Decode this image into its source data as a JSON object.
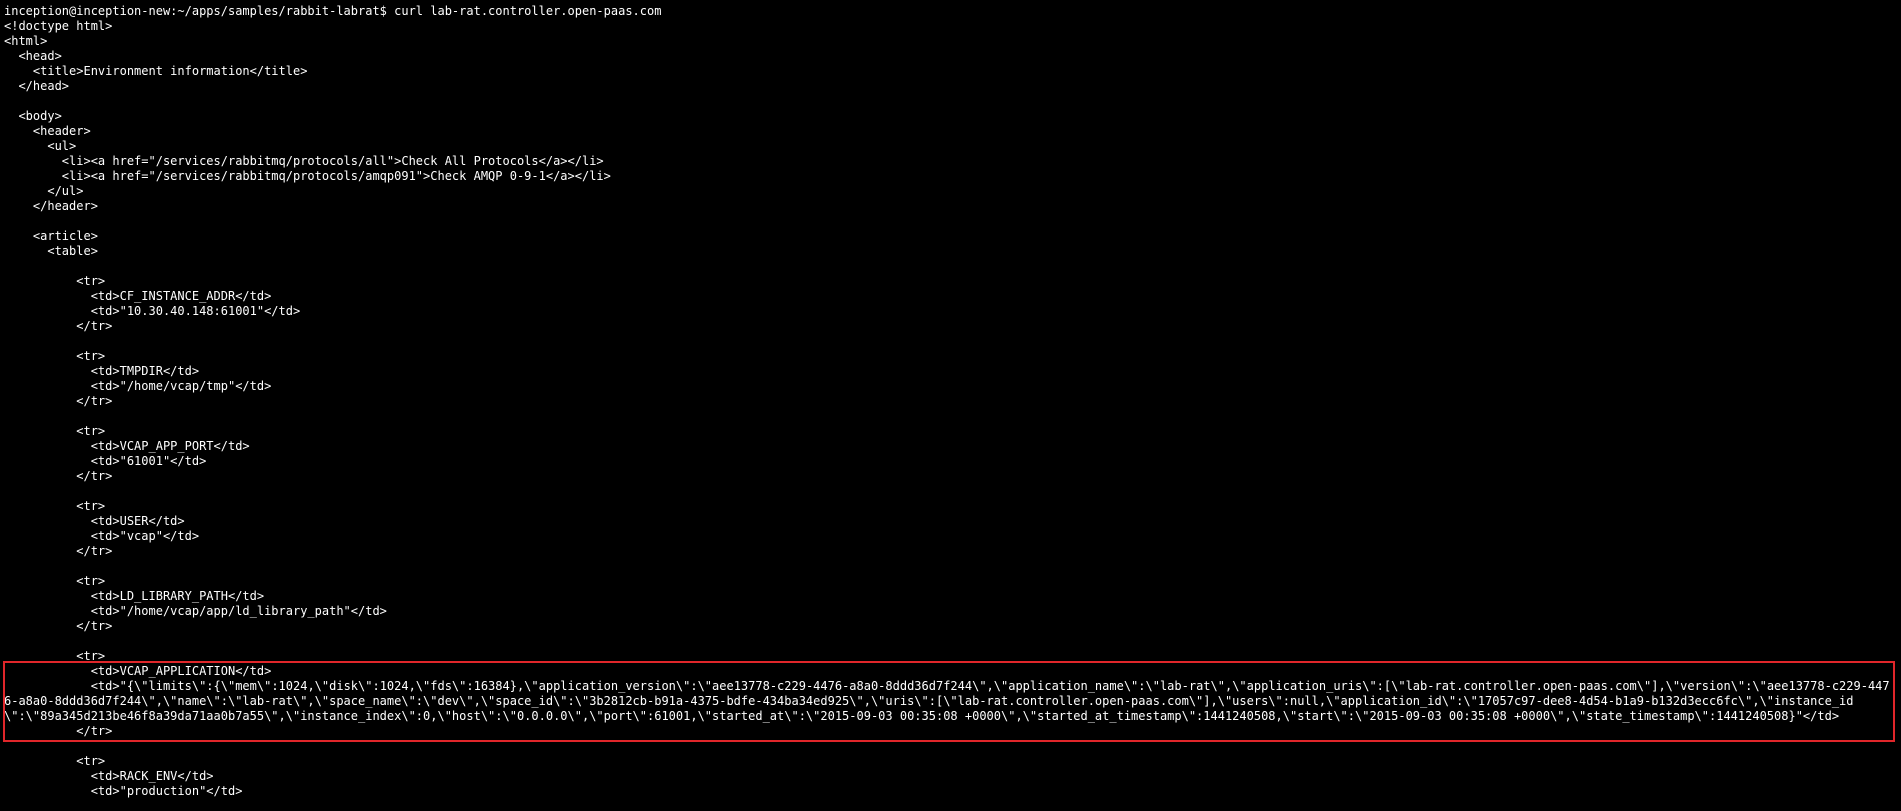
{
  "terminal": {
    "highlight_color": "#e0262a",
    "background_color": "#000000",
    "text_color": "#ffffff",
    "lines": [
      "inception@inception-new:~/apps/samples/rabbit-labrat$ curl lab-rat.controller.open-paas.com",
      "<!doctype html>",
      "<html>",
      "  <head>",
      "    <title>Environment information</title>",
      "  </head>",
      "",
      "  <body>",
      "    <header>",
      "      <ul>",
      "        <li><a href=\"/services/rabbitmq/protocols/all\">Check All Protocols</a></li>",
      "        <li><a href=\"/services/rabbitmq/protocols/amqp091\">Check AMQP 0-9-1</a></li>",
      "      </ul>",
      "    </header>",
      "",
      "    <article>",
      "      <table>",
      "",
      "          <tr>",
      "            <td>CF_INSTANCE_ADDR</td>",
      "            <td>\"10.30.40.148:61001\"</td>",
      "          </tr>",
      "",
      "          <tr>",
      "            <td>TMPDIR</td>",
      "            <td>\"/home/vcap/tmp\"</td>",
      "          </tr>",
      "",
      "          <tr>",
      "            <td>VCAP_APP_PORT</td>",
      "            <td>\"61001\"</td>",
      "          </tr>",
      "",
      "          <tr>",
      "            <td>USER</td>",
      "            <td>\"vcap\"</td>",
      "          </tr>",
      "",
      "          <tr>",
      "            <td>LD_LIBRARY_PATH</td>",
      "            <td>\"/home/vcap/app/ld_library_path\"</td>",
      "          </tr>",
      "",
      "          <tr>"
    ],
    "highlighted_lines": [
      "            <td>VCAP_APPLICATION</td>",
      "            <td>\"{\\\"limits\\\":{\\\"mem\\\":1024,\\\"disk\\\":1024,\\\"fds\\\":16384},\\\"application_version\\\":\\\"aee13778-c229-4476-a8a0-8ddd36d7f244\\\",\\\"application_name\\\":\\\"lab-rat\\\",\\\"application_uris\\\":[\\\"lab-rat.controller.open-paas.com\\\"],\\\"version\\\":\\\"aee13778-c229-4476-a8a0-8ddd36d7f244\\\",\\\"name\\\":\\\"lab-rat\\\",\\\"space_name\\\":\\\"dev\\\",\\\"space_id\\\":\\\"3b2812cb-b91a-4375-bdfe-434ba34ed925\\\",\\\"uris\\\":[\\\"lab-rat.controller.open-paas.com\\\"],\\\"users\\\":null,\\\"application_id\\\":\\\"17057c97-dee8-4d54-b1a9-b132d3ecc6fc\\\",\\\"instance_id\\\":\\\"89a345d213be46f8a39da71aa0b7a55\\\",\\\"instance_index\\\":0,\\\"host\\\":\\\"0.0.0.0\\\",\\\"port\\\":61001,\\\"started_at\\\":\\\"2015-09-03 00:35:08 +0000\\\",\\\"started_at_timestamp\\\":1441240508,\\\"start\\\":\\\"2015-09-03 00:35:08 +0000\\\",\\\"state_timestamp\\\":1441240508}\"</td>",
      "          </tr>"
    ],
    "trailing_lines": [
      "",
      "          <tr>",
      "            <td>RACK_ENV</td>",
      "            <td>\"production\"</td>"
    ]
  }
}
